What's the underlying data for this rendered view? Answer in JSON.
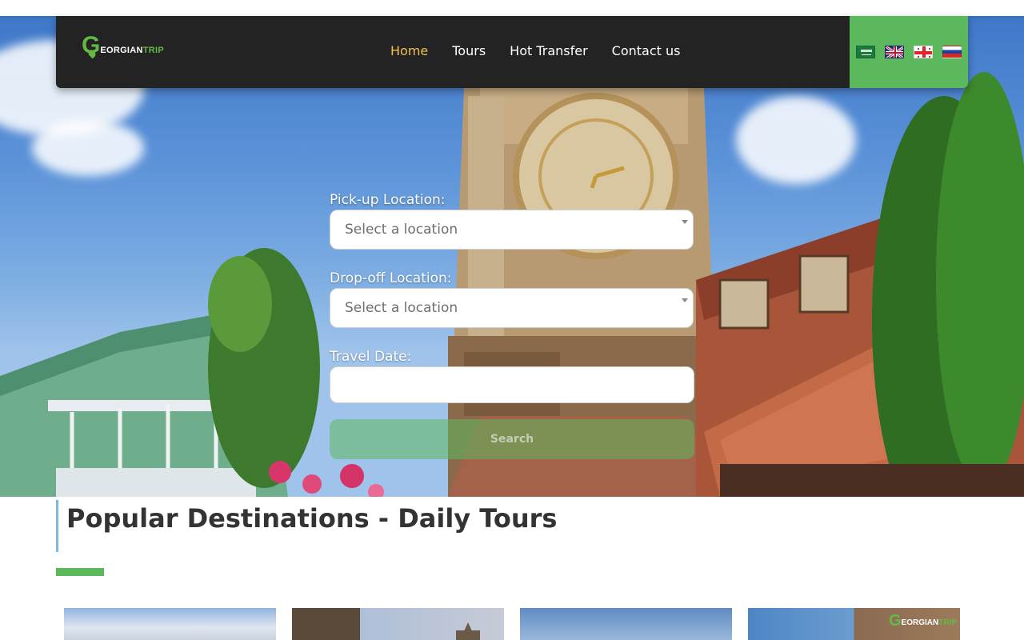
{
  "brand": {
    "logo_letter": "G",
    "logo_rest": "EORGIAN",
    "logo_trip": "TRIP"
  },
  "nav": {
    "items": [
      {
        "label": "Home",
        "active": true
      },
      {
        "label": "Tours",
        "active": false
      },
      {
        "label": "Hot Transfer",
        "active": false
      },
      {
        "label": "Contact us",
        "active": false
      }
    ]
  },
  "languages": [
    {
      "name": "arabic-flag-icon",
      "code": "ar"
    },
    {
      "name": "uk-flag-icon",
      "code": "en"
    },
    {
      "name": "georgia-flag-icon",
      "code": "ka"
    },
    {
      "name": "russia-flag-icon",
      "code": "ru"
    }
  ],
  "search_form": {
    "pickup_label": "Pick-up Location:",
    "pickup_placeholder": "Select a location",
    "dropoff_label": "Drop-off Location:",
    "dropoff_placeholder": "Select a location",
    "date_label": "Travel Date:",
    "date_value": "",
    "search_label": "Search"
  },
  "section": {
    "title": "Popular Destinations - Daily Tours"
  },
  "colors": {
    "accent": "#5cb85c",
    "nav_bg": "#232323",
    "active_nav": "#f2c14e",
    "title": "#333333"
  }
}
